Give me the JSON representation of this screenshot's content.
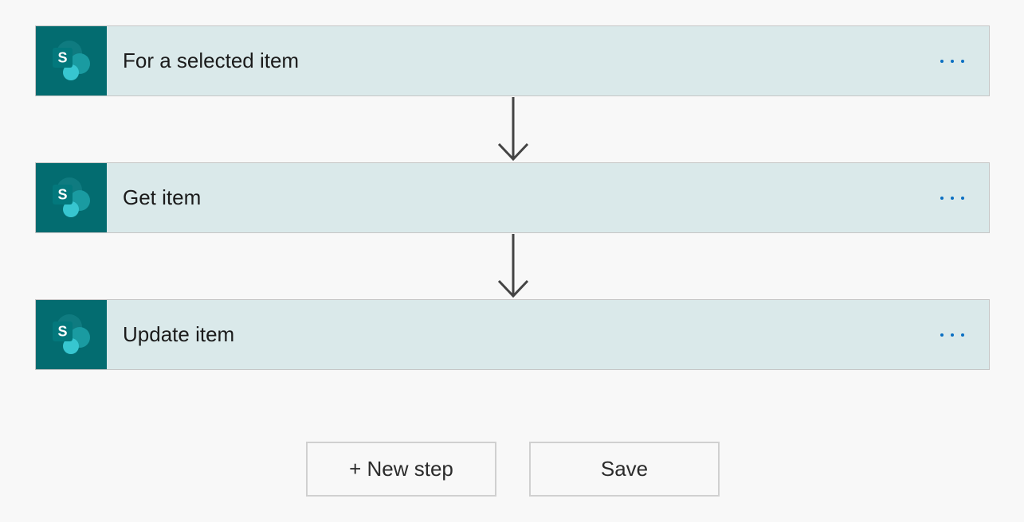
{
  "flow": {
    "steps": [
      {
        "title": "For a selected item",
        "icon": "sharepoint-icon",
        "icon_letter": "S"
      },
      {
        "title": "Get item",
        "icon": "sharepoint-icon",
        "icon_letter": "S"
      },
      {
        "title": "Update item",
        "icon": "sharepoint-icon",
        "icon_letter": "S"
      }
    ],
    "more_icon": "ellipsis-icon",
    "connector_icon": "arrow-down-icon"
  },
  "actions": {
    "new_step_label": "+ New step",
    "save_label": "Save"
  },
  "colors": {
    "card_background": "#dae9ea",
    "icon_background": "#036c70",
    "accent_dots": "#0a6fc2"
  }
}
